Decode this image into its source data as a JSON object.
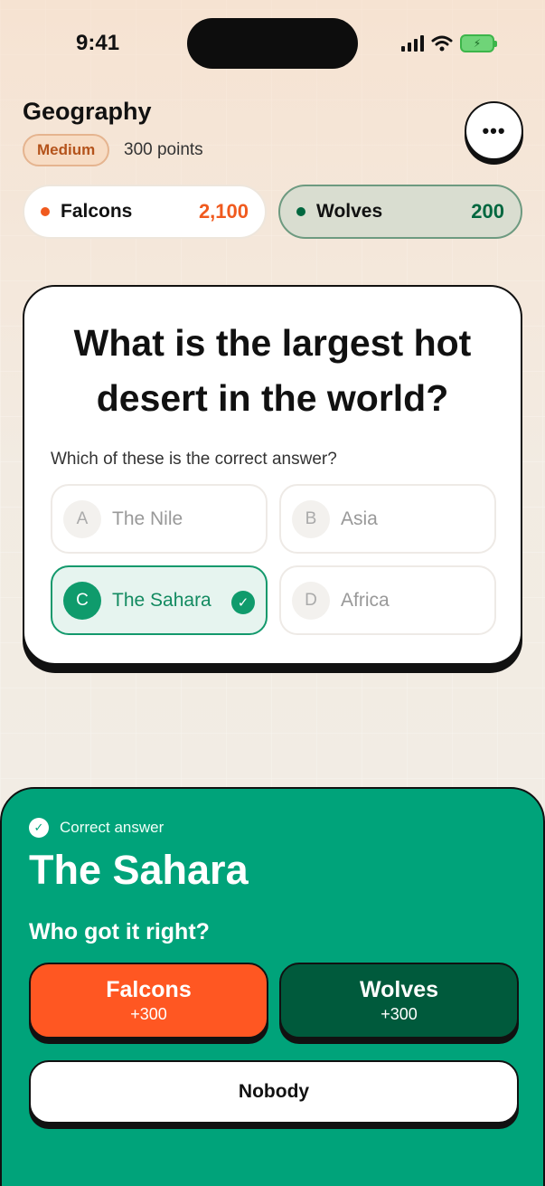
{
  "status_bar": {
    "time": "9:41",
    "icons": [
      "signal-icon",
      "wifi-icon",
      "battery-charging-icon"
    ]
  },
  "header": {
    "title": "Geography",
    "difficulty": "Medium",
    "points": "300 points",
    "more_label": "•••"
  },
  "teams": [
    {
      "name": "Falcons",
      "score": "2,100",
      "color": "#f05a1e"
    },
    {
      "name": "Wolves",
      "score": "200",
      "color": "#00673f"
    }
  ],
  "question": {
    "text": "What is the largest hot desert in the world?",
    "subtitle": "Which of these is the correct answer?",
    "options": [
      {
        "letter": "A",
        "label": "The Nile"
      },
      {
        "letter": "B",
        "label": "Asia"
      },
      {
        "letter": "C",
        "label": "The Sahara",
        "correct": true
      },
      {
        "letter": "D",
        "label": "Africa"
      }
    ]
  },
  "result": {
    "label": "Correct answer",
    "answer": "The Sahara",
    "prompt": "Who got it right?",
    "buttons": [
      {
        "name": "Falcons",
        "points": "+300"
      },
      {
        "name": "Wolves",
        "points": "+300"
      }
    ],
    "nobody_label": "Nobody"
  },
  "colors": {
    "accent_green": "#00a37a",
    "falcons_orange": "#ff5722",
    "wolves_green": "#005a3c"
  }
}
